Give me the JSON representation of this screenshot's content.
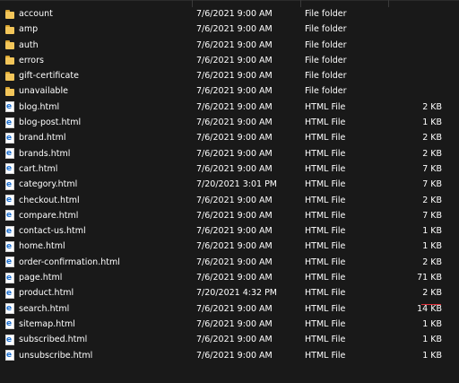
{
  "files": [
    {
      "name": "account",
      "date": "7/6/2021 9:00 AM",
      "type": "File folder",
      "size": "",
      "icon": "folder-icon"
    },
    {
      "name": "amp",
      "date": "7/6/2021 9:00 AM",
      "type": "File folder",
      "size": "",
      "icon": "folder-icon"
    },
    {
      "name": "auth",
      "date": "7/6/2021 9:00 AM",
      "type": "File folder",
      "size": "",
      "icon": "folder-icon"
    },
    {
      "name": "errors",
      "date": "7/6/2021 9:00 AM",
      "type": "File folder",
      "size": "",
      "icon": "folder-icon"
    },
    {
      "name": "gift-certificate",
      "date": "7/6/2021 9:00 AM",
      "type": "File folder",
      "size": "",
      "icon": "folder-icon"
    },
    {
      "name": "unavailable",
      "date": "7/6/2021 9:00 AM",
      "type": "File folder",
      "size": "",
      "icon": "folder-icon"
    },
    {
      "name": "blog.html",
      "date": "7/6/2021 9:00 AM",
      "type": "HTML File",
      "size": "2 KB",
      "icon": "html-file-icon"
    },
    {
      "name": "blog-post.html",
      "date": "7/6/2021 9:00 AM",
      "type": "HTML File",
      "size": "1 KB",
      "icon": "html-file-icon"
    },
    {
      "name": "brand.html",
      "date": "7/6/2021 9:00 AM",
      "type": "HTML File",
      "size": "2 KB",
      "icon": "html-file-icon"
    },
    {
      "name": "brands.html",
      "date": "7/6/2021 9:00 AM",
      "type": "HTML File",
      "size": "2 KB",
      "icon": "html-file-icon"
    },
    {
      "name": "cart.html",
      "date": "7/6/2021 9:00 AM",
      "type": "HTML File",
      "size": "7 KB",
      "icon": "html-file-icon"
    },
    {
      "name": "category.html",
      "date": "7/20/2021 3:01 PM",
      "type": "HTML File",
      "size": "7 KB",
      "icon": "html-file-icon"
    },
    {
      "name": "checkout.html",
      "date": "7/6/2021 9:00 AM",
      "type": "HTML File",
      "size": "2 KB",
      "icon": "html-file-icon"
    },
    {
      "name": "compare.html",
      "date": "7/6/2021 9:00 AM",
      "type": "HTML File",
      "size": "7 KB",
      "icon": "html-file-icon"
    },
    {
      "name": "contact-us.html",
      "date": "7/6/2021 9:00 AM",
      "type": "HTML File",
      "size": "1 KB",
      "icon": "html-file-icon"
    },
    {
      "name": "home.html",
      "date": "7/6/2021 9:00 AM",
      "type": "HTML File",
      "size": "1 KB",
      "icon": "html-file-icon"
    },
    {
      "name": "order-confirmation.html",
      "date": "7/6/2021 9:00 AM",
      "type": "HTML File",
      "size": "2 KB",
      "icon": "html-file-icon"
    },
    {
      "name": "page.html",
      "date": "7/6/2021 9:00 AM",
      "type": "HTML File",
      "size": "71 KB",
      "icon": "html-file-icon"
    },
    {
      "name": "product.html",
      "date": "7/20/2021 4:32 PM",
      "type": "HTML File",
      "size": "2 KB",
      "icon": "html-file-icon"
    },
    {
      "name": "search.html",
      "date": "7/6/2021 9:00 AM",
      "type": "HTML File",
      "size": "14 KB",
      "icon": "html-file-icon"
    },
    {
      "name": "sitemap.html",
      "date": "7/6/2021 9:00 AM",
      "type": "HTML File",
      "size": "1 KB",
      "icon": "html-file-icon"
    },
    {
      "name": "subscribed.html",
      "date": "7/6/2021 9:00 AM",
      "type": "HTML File",
      "size": "1 KB",
      "icon": "html-file-icon"
    },
    {
      "name": "unsubscribe.html",
      "date": "7/6/2021 9:00 AM",
      "type": "HTML File",
      "size": "1 KB",
      "icon": "html-file-icon"
    }
  ],
  "colors": {
    "background": "#191919",
    "text": "#ffffff",
    "folder": "#f3c65a",
    "html_icon": "#1a6fd1",
    "annotation": "#e0303a"
  }
}
